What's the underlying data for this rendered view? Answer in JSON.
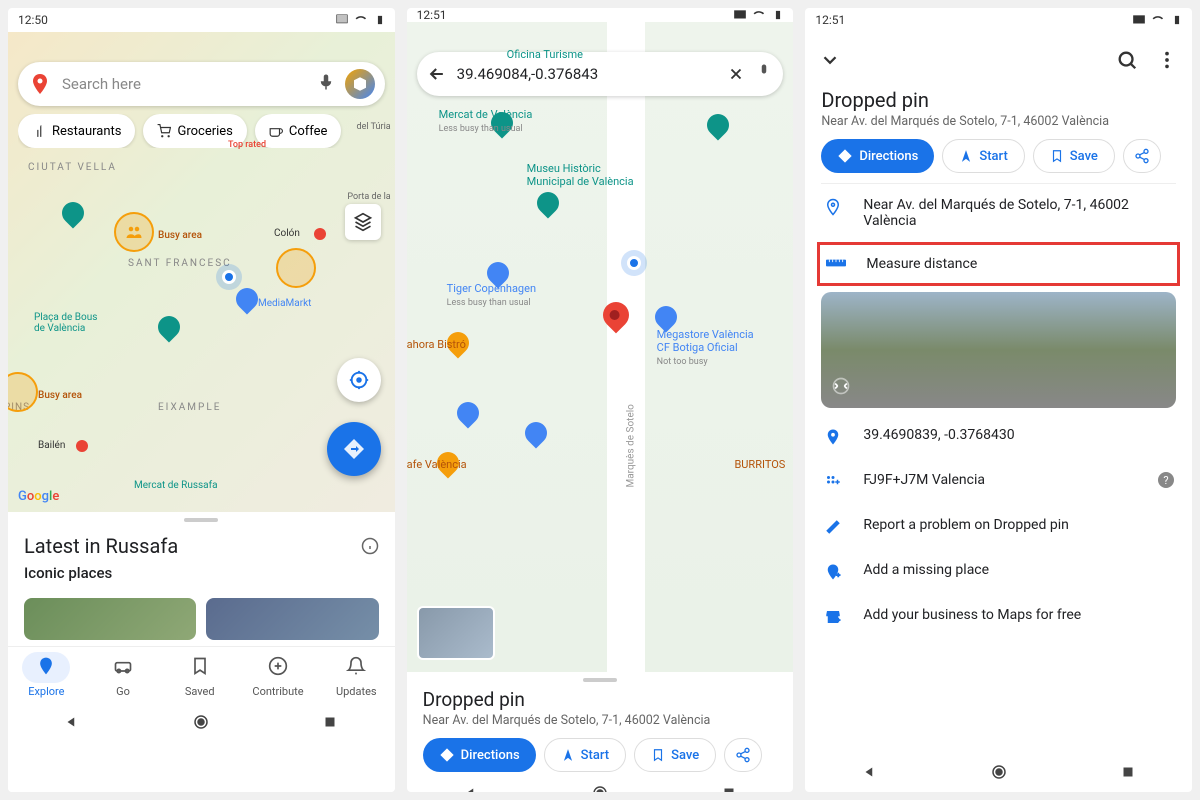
{
  "s1": {
    "time": "12:50",
    "search_placeholder": "Search here",
    "chips": [
      "Restaurants",
      "Groceries",
      "Coffee"
    ],
    "busy": "Busy area",
    "districts": [
      "CIUTAT VELLA",
      "SANT FRANCESC",
      "EIXAMPLE",
      "PINS"
    ],
    "poi": {
      "placa": "Plaça de Bous\nde València",
      "media": "MediaMarkt",
      "colon": "Colón",
      "bailen": "Bailén",
      "russafa": "Mercat de Russafa",
      "porta": "Porta de la",
      "turia": "del Túria"
    },
    "toprated": "Top rated",
    "google": "Google",
    "sheet_title": "Latest in Russafa",
    "iconic": "Iconic places",
    "nav": [
      "Explore",
      "Go",
      "Saved",
      "Contribute",
      "Updates"
    ]
  },
  "s2": {
    "time": "12:51",
    "coords": "39.469084,-0.376843",
    "poi": {
      "oficina": "Oficina Turisme",
      "mercat": "Mercat de València",
      "mercat_b": "Less busy than usual",
      "museu": "Museu Històric\nMunicipal de València",
      "tiger": "Tiger Copenhagen",
      "tiger_b": "Less busy than usual",
      "ahora": "ahora Bistró",
      "mega": "Megastore València\nCF Botiga Oficial",
      "mega_b": "Not too busy",
      "cafe": "afe València",
      "burr": "BURRITOS",
      "sotelo": "Marquès de Sotelo"
    },
    "sheet_title": "Dropped pin",
    "addr": "Near Av. del Marqués de Sotelo, 7-1, 46002 València",
    "actions": {
      "dir": "Directions",
      "start": "Start",
      "save": "Save"
    }
  },
  "s3": {
    "time": "12:51",
    "title": "Dropped pin",
    "addr": "Near Av. del Marqués de Sotelo, 7-1, 46002 València",
    "actions": {
      "dir": "Directions",
      "start": "Start",
      "save": "Save"
    },
    "addr2": "Near Av. del Marqués de Sotelo, 7-1, 46002 València",
    "measure": "Measure distance",
    "coords": "39.4690839, -0.3768430",
    "plus": "FJ9F+J7M Valencia",
    "report": "Report a problem on Dropped pin",
    "missing": "Add a missing place",
    "business": "Add your business to Maps for free"
  }
}
